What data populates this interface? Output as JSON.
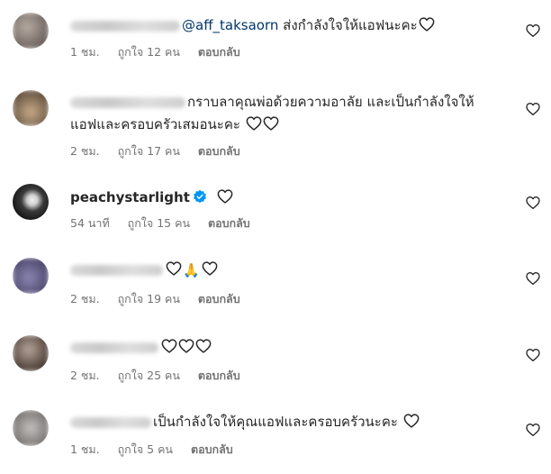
{
  "comments": [
    {
      "mention": "@aff_taksaorn",
      "text": " ส่งกำลังใจให้แอฟนะคะ",
      "time": "1 ชม.",
      "likes": "ถูกใจ 12 คน",
      "reply": "ตอบกลับ",
      "avatar_color": "#8a7f78"
    },
    {
      "text": "กราบลาคุณพ่อด้วยความอาลัย และเป็นกำลังใจให้",
      "text2": "แอฟและครอบครัวเสมอนะคะ",
      "time": "2 ชม.",
      "likes": "ถูกใจ 17 คน",
      "reply": "ตอบกลับ",
      "avatar_color": "#a58c70"
    },
    {
      "username": "peachystarlight",
      "time": "54 นาที",
      "likes": "ถูกใจ 15 คน",
      "reply": "ตอบกลับ",
      "avatar_color": "#2e2e2e"
    },
    {
      "emoji": "🙏",
      "time": "2 ชม.",
      "likes": "ถูกใจ 19 คน",
      "reply": "ตอบกลับ",
      "avatar_color": "#6e6a8c"
    },
    {
      "time": "2 ชม.",
      "likes": "ถูกใจ 25 คน",
      "reply": "ตอบกลับ",
      "avatar_color": "#7a6a60"
    },
    {
      "text": "เป็นกำลังใจให้คุณแอฟและครอบครัวนะคะ",
      "time": "1 ชม.",
      "likes": "ถูกใจ 5 คน",
      "reply": "ตอบกลับ",
      "avatar_color": "#9b9896"
    }
  ],
  "icons": {
    "like": "heart-outline-icon",
    "verified": "verified-badge-icon"
  },
  "colors": {
    "mention": "#00376b",
    "meta": "#737373",
    "verified": "#0095f6"
  }
}
